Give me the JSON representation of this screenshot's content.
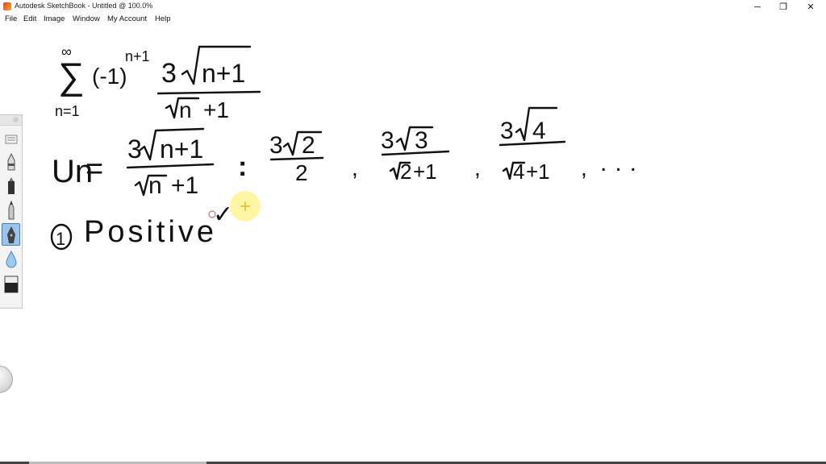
{
  "window": {
    "title": "Autodesk SketchBook - Untitled @ 100.0%",
    "minimize_glyph": "─",
    "restore_glyph": "❐",
    "close_glyph": "✕"
  },
  "menu": {
    "file": "File",
    "edit": "Edit",
    "image": "Image",
    "window": "Window",
    "my_account": "My Account",
    "help": "Help"
  },
  "sketch": {
    "series_sigma": "∑",
    "series_top": "∞",
    "series_bottom": "n=1",
    "series_sign": "(-1)",
    "series_sign_exp": "n+1",
    "series_num_coef": "3",
    "series_num_radicand": "n+1",
    "series_den_radicand": "n",
    "series_den_tail": "+1",
    "un_label": "Un",
    "equals": "=",
    "un_num_coef": "3",
    "un_num_radicand": "n+1",
    "un_den_radicand": "n",
    "un_den_tail": "+1",
    "colon": ":",
    "t1_num_coef": "3",
    "t1_num_radicand": "2",
    "t1_den": "2",
    "comma": ",",
    "t2_num_coef": "3",
    "t2_num_radicand": "3",
    "t2_den_radicand": "2",
    "t2_den_tail": "+1",
    "t3_num_coef": "3",
    "t3_num_radicand": "4",
    "t3_den_radicand": "4",
    "t3_den_tail": "+1",
    "ellipsis": "...",
    "step_number": "1",
    "step_text": "Positive",
    "check": "✓"
  },
  "colors": {
    "ink": "#111111",
    "cursor_highlight": "#fff59a",
    "selected_tool": "#9cc3ea"
  }
}
